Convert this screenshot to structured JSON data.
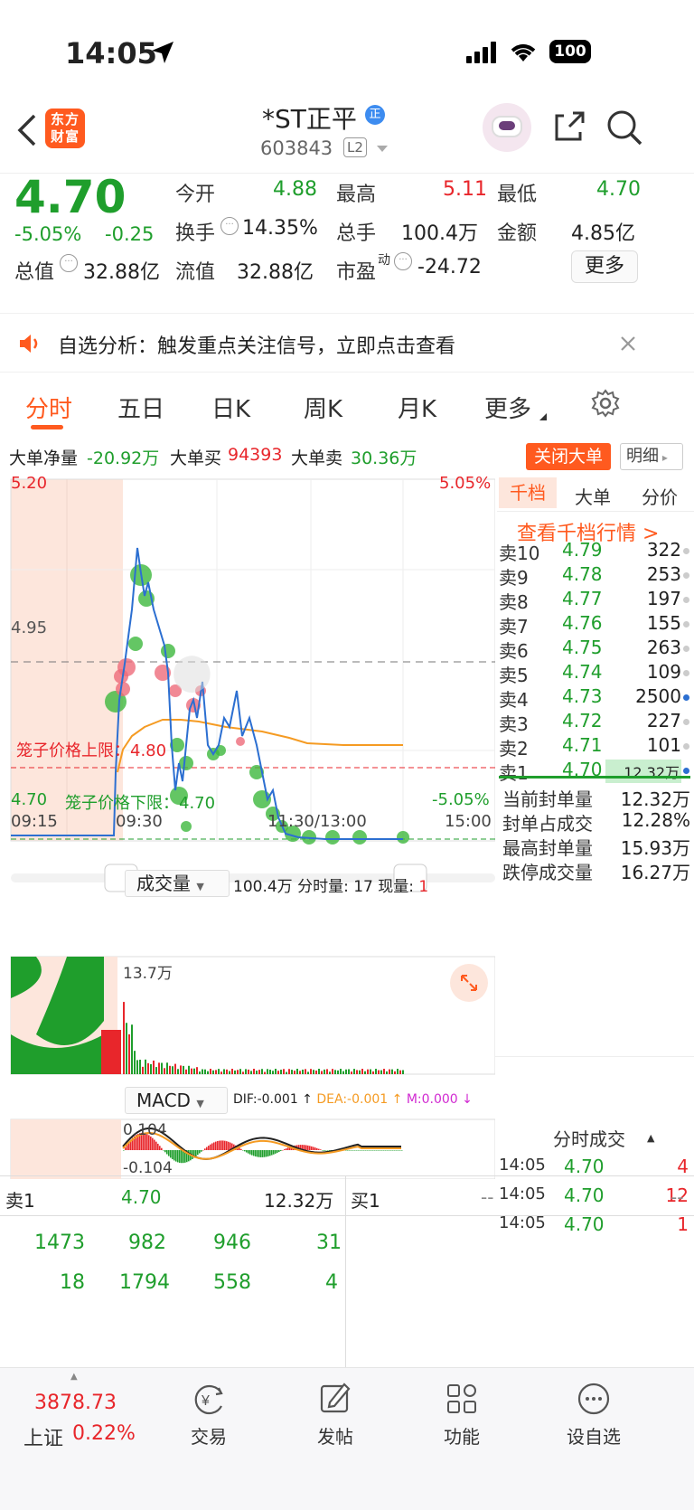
{
  "status": {
    "time": "14:05",
    "battery": "100"
  },
  "nav": {
    "logo_text": "东方财富",
    "title": "*ST正平",
    "badge": "正",
    "code": "603843",
    "level": "L2"
  },
  "quote": {
    "price": "4.70",
    "change_pct": "-5.05%",
    "change": "-0.25",
    "open_label": "今开",
    "open": "4.88",
    "high_label": "最高",
    "high": "5.11",
    "low_label": "最低",
    "low": "4.70",
    "turnover_label": "换手",
    "turnover": "14.35%",
    "volume_label": "总手",
    "volume": "100.4万",
    "amount_label": "金额",
    "amount": "4.85亿",
    "mcap_label": "总值",
    "mcap": "32.88亿",
    "float_label": "流值",
    "float": "32.88亿",
    "pe_label": "市盈",
    "pe_sup": "动",
    "pe": "-24.72",
    "more": "更多"
  },
  "banner": {
    "text": "自选分析：触发重点关注信号，立即点击查看"
  },
  "tabs": [
    "分时",
    "五日",
    "日K",
    "周K",
    "月K",
    "更多"
  ],
  "bigorder": {
    "net_label": "大单净量",
    "net": "-20.92万",
    "buy_label": "大单买",
    "buy": "94393",
    "sell_label": "大单卖",
    "sell": "30.36万",
    "close_btn": "关闭大单",
    "detail_btn": "明细"
  },
  "chart": {
    "top_price": "5.20",
    "top_pct": "5.05%",
    "mid_price": "4.95",
    "bottom_price": "4.70",
    "bottom_pct": "-5.05%",
    "upper_cage": "笼子价格上限：4.80",
    "lower_cage": "笼子价格下限：4.70",
    "times": [
      "09:15",
      "09:30",
      "11:30/13:00",
      "15:00"
    ],
    "volume_label": "成交量",
    "volume_total": "100.4万",
    "minute_vol_label": "分时量:",
    "minute_vol": "17",
    "now_vol_label": "现量:",
    "now_vol": "1",
    "vol_max": "13.7万",
    "macd_label": "MACD",
    "dif": "DIF:-0.001",
    "dea": "DEA:-0.001",
    "m": "M:0.000",
    "macd_top": "0.104",
    "macd_bottom": "-0.104"
  },
  "orderbook": {
    "tabs": [
      "千档",
      "大单",
      "分价"
    ],
    "link": "查看千档行情 >",
    "asks": [
      {
        "label": "卖10",
        "price": "4.79",
        "vol": "322"
      },
      {
        "label": "卖9",
        "price": "4.78",
        "vol": "253"
      },
      {
        "label": "卖8",
        "price": "4.77",
        "vol": "197"
      },
      {
        "label": "卖7",
        "price": "4.76",
        "vol": "155"
      },
      {
        "label": "卖6",
        "price": "4.75",
        "vol": "263"
      },
      {
        "label": "卖5",
        "price": "4.74",
        "vol": "109"
      },
      {
        "label": "卖4",
        "price": "4.73",
        "vol": "2500"
      },
      {
        "label": "卖3",
        "price": "4.72",
        "vol": "227"
      },
      {
        "label": "卖2",
        "price": "4.71",
        "vol": "101"
      },
      {
        "label": "卖1",
        "price": "4.70",
        "vol": "12.32万"
      }
    ],
    "stats": [
      {
        "label": "当前封单量",
        "value": "12.32万"
      },
      {
        "label": "封单占成交",
        "value": "12.28%"
      },
      {
        "label": "最高封单量",
        "value": "15.93万"
      },
      {
        "label": "跌停成交量",
        "value": "16.27万"
      }
    ],
    "ticks_title": "分时成交",
    "ticks": [
      {
        "time": "14:05",
        "price": "4.70",
        "vol": "4"
      },
      {
        "time": "14:05",
        "price": "4.70",
        "vol": "12"
      },
      {
        "time": "14:05",
        "price": "4.70",
        "vol": "1"
      }
    ]
  },
  "bottom": {
    "sell1_label": "卖1",
    "sell1_price": "4.70",
    "sell1_vol": "12.32万",
    "buy1_label": "买1",
    "buy1_price": "--",
    "buy1_vol": "--",
    "row1": [
      "1473",
      "982",
      "946",
      "31"
    ],
    "row2": [
      "18",
      "1794",
      "558",
      "4"
    ]
  },
  "tabbar": {
    "index_value": "3878.73",
    "index_name": "上证",
    "index_pct": "0.22%",
    "items": [
      "交易",
      "发帖",
      "功能",
      "设自选"
    ]
  }
}
